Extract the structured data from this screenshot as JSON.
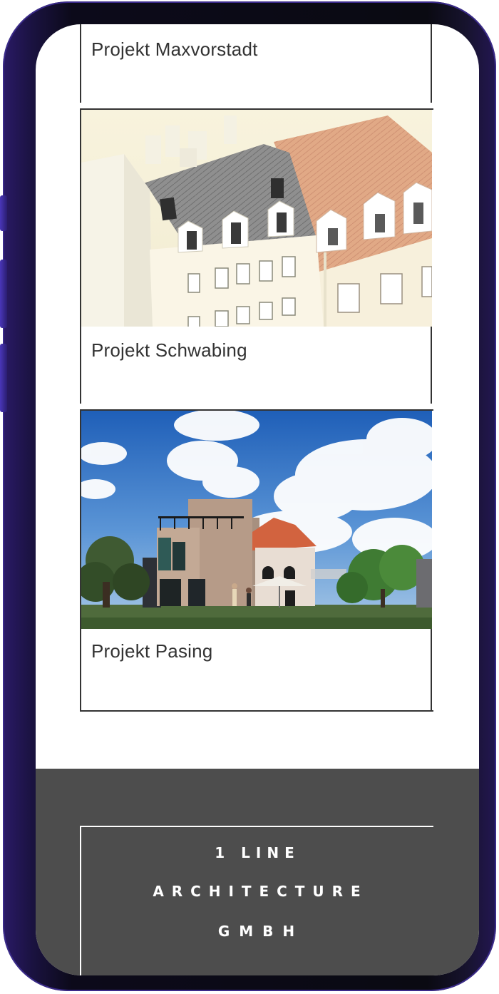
{
  "projects": [
    {
      "title": "Projekt Maxvorstadt"
    },
    {
      "title": "Projekt Schwabing"
    },
    {
      "title": "Projekt Pasing"
    }
  ],
  "footer": {
    "line1": "1  LINE",
    "line2": "A R C H I T E C T U R E",
    "line3": "G M B H"
  },
  "colors": {
    "border": "#333333",
    "footer_bg": "#4d4d4d",
    "phone_accent": "#3a2a8a"
  }
}
